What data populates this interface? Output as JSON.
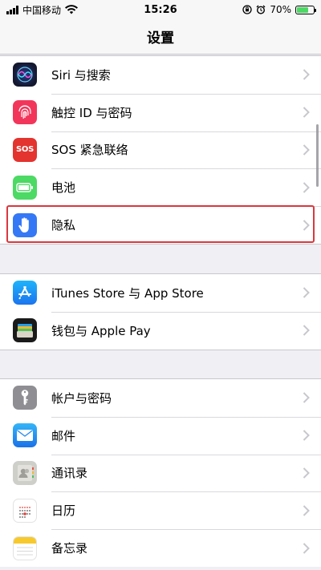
{
  "status_bar": {
    "carrier": "中国移动",
    "time": "15:26",
    "battery_percent": "70%",
    "battery_level": 0.7,
    "signal_icon": "signal-bars-icon",
    "wifi_icon": "wifi-icon",
    "lock_rotation_icon": "orientation-lock-icon",
    "alarm_icon": "alarm-clock-icon"
  },
  "nav": {
    "title": "设置"
  },
  "groups": [
    {
      "items": [
        {
          "label": "Siri 与搜索",
          "icon": "siri-icon",
          "color": "#1b1f3b"
        },
        {
          "label": "触控 ID 与密码",
          "icon": "fingerprint-icon",
          "color": "#f2365b"
        },
        {
          "label": "SOS 紧急联络",
          "icon": "sos-icon",
          "color": "#e3342f",
          "icon_text": "SOS"
        },
        {
          "label": "电池",
          "icon": "battery-icon",
          "color": "#4cd964"
        },
        {
          "label": "隐私",
          "icon": "hand-icon",
          "color": "#3478f6",
          "highlighted": true
        }
      ]
    },
    {
      "items": [
        {
          "label": "iTunes Store 与 App Store",
          "icon": "app-store-icon",
          "color": "#1d8cf5"
        },
        {
          "label": "钱包与 Apple Pay",
          "icon": "wallet-icon",
          "color": "#1a1a1a"
        }
      ]
    },
    {
      "items": [
        {
          "label": "帐户与密码",
          "icon": "key-icon",
          "color": "#8e8e93"
        },
        {
          "label": "邮件",
          "icon": "mail-icon",
          "color": "#2196f3"
        },
        {
          "label": "通讯录",
          "icon": "contacts-icon",
          "color": "#b9b9b4"
        },
        {
          "label": "日历",
          "icon": "calendar-icon",
          "color": "#ffffff"
        },
        {
          "label": "备忘录",
          "icon": "notes-icon",
          "color": "#ffffff"
        }
      ]
    }
  ],
  "colors": {
    "highlight_border": "#d9383e",
    "background": "#efeff4",
    "chevron": "#c7c7cc"
  }
}
